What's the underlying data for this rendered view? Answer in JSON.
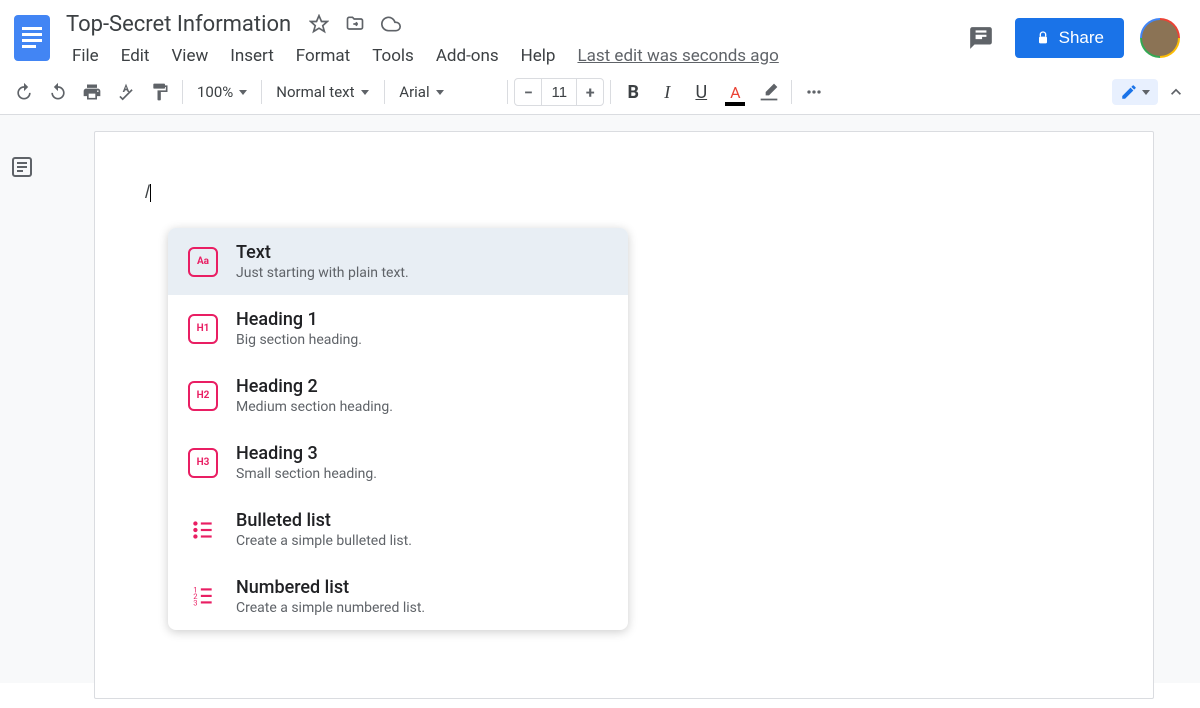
{
  "document": {
    "title": "Top-Secret Information"
  },
  "menubar": {
    "items": [
      "File",
      "Edit",
      "View",
      "Insert",
      "Format",
      "Tools",
      "Add-ons",
      "Help"
    ],
    "last_edit": "Last edit was seconds ago"
  },
  "header": {
    "share_label": "Share"
  },
  "toolbar": {
    "zoom": "100%",
    "style": "Normal text",
    "font": "Arial",
    "font_size": "11"
  },
  "editor": {
    "typed": "/"
  },
  "popup": {
    "items": [
      {
        "icon": "Aa",
        "title": "Text",
        "desc": "Just starting with plain text.",
        "selected": true,
        "type": "box"
      },
      {
        "icon": "H1",
        "title": "Heading 1",
        "desc": "Big section heading.",
        "selected": false,
        "type": "box"
      },
      {
        "icon": "H2",
        "title": "Heading 2",
        "desc": "Medium section heading.",
        "selected": false,
        "type": "box"
      },
      {
        "icon": "H3",
        "title": "Heading 3",
        "desc": "Small section heading.",
        "selected": false,
        "type": "box"
      },
      {
        "icon": "bullets",
        "title": "Bulleted list",
        "desc": "Create a simple bulleted list.",
        "selected": false,
        "type": "svg"
      },
      {
        "icon": "numbers",
        "title": "Numbered list",
        "desc": "Create a simple numbered list.",
        "selected": false,
        "type": "svg"
      }
    ]
  }
}
